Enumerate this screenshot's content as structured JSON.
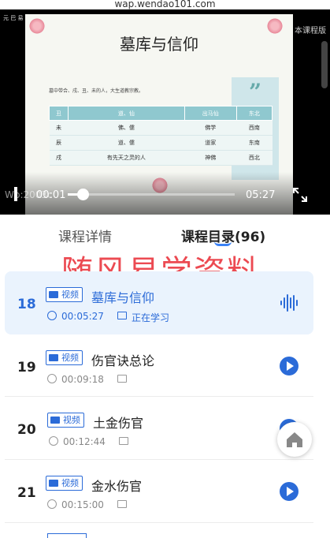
{
  "browser": {
    "url": "wap.wendao101.com"
  },
  "player": {
    "slide_title": "墓库与信仰",
    "slide_text": "墓中带合、戌、丑、未的人，大生道教宗教。",
    "table": {
      "headers": [
        "丑",
        "道、仙",
        "出马仙",
        "东北"
      ],
      "rows": [
        [
          "未",
          "佛、儒",
          "佛学",
          "西南"
        ],
        [
          "辰",
          "道、儒",
          "道家",
          "东南"
        ],
        [
          "戌",
          "有先天之灵的人",
          "神佛",
          "西北"
        ]
      ]
    },
    "corner_note": "元 巴 易",
    "top_right_text": "本课程版",
    "watermark": "Wb:2003c",
    "current_time": "00:01",
    "duration": "05:27",
    "progress_fraction": 0.09
  },
  "tabs": [
    {
      "label": "课程详情",
      "active": false
    },
    {
      "label": "课程目录(96)",
      "active": true
    }
  ],
  "overlay_watermark": "随风易学资料",
  "lessons": [
    {
      "number": "18",
      "type": "视频",
      "title": "墓库与信仰",
      "duration": "00:05:27",
      "status": "正在学习",
      "active": true
    },
    {
      "number": "19",
      "type": "视频",
      "title": "伤官诀总论",
      "duration": "00:09:18",
      "status": "",
      "active": false
    },
    {
      "number": "20",
      "type": "视频",
      "title": "土金伤官",
      "duration": "00:12:44",
      "status": "",
      "active": false
    },
    {
      "number": "21",
      "type": "视频",
      "title": "金水伤官",
      "duration": "00:15:00",
      "status": "",
      "active": false
    }
  ],
  "colors": {
    "accent": "#2b6bd8",
    "watermark_red": "#ec4a52",
    "active_row_bg": "#eaf3fd"
  }
}
